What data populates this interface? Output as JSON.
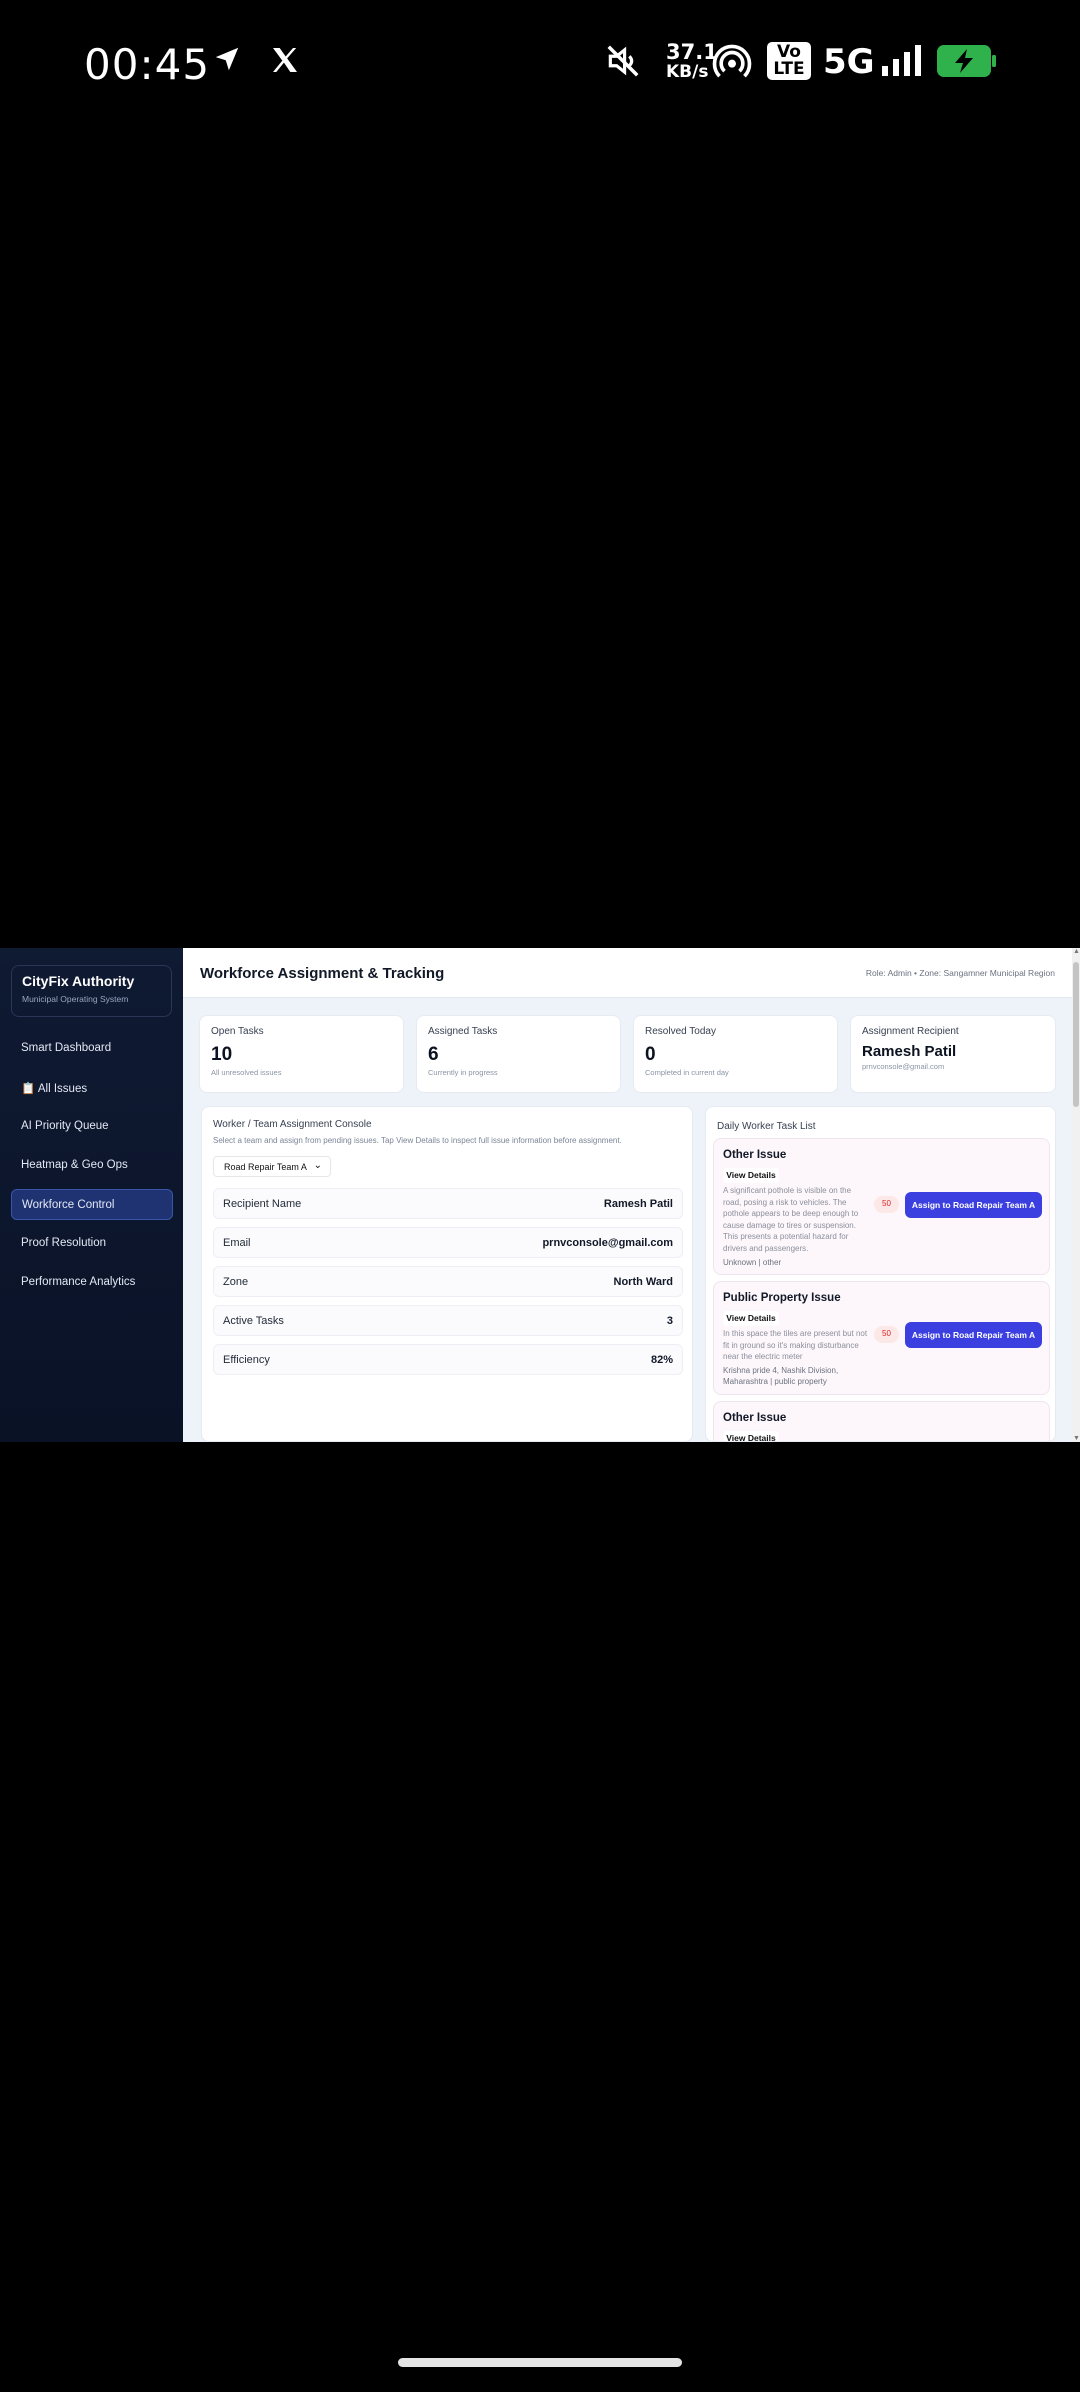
{
  "status_bar": {
    "time": "00:45",
    "net_speed_value": "37.1",
    "net_speed_unit": "KB/s",
    "volte_line1": "Vo",
    "volte_line2": "LTE",
    "network": "5G",
    "icons": [
      "location-arrow-icon",
      "x-logo-icon",
      "mute-icon",
      "hotspot-icon",
      "signal-icon",
      "battery-charging-icon"
    ]
  },
  "sidebar": {
    "brand_title": "CityFix Authority",
    "brand_subtitle": "Municipal Operating System",
    "items": [
      {
        "label": "Smart Dashboard"
      },
      {
        "label": "📋 All Issues"
      },
      {
        "label": "AI Priority Queue"
      },
      {
        "label": "Heatmap & Geo Ops"
      },
      {
        "label": "Workforce Control",
        "active": true
      },
      {
        "label": "Proof Resolution"
      },
      {
        "label": "Performance Analytics"
      }
    ]
  },
  "header": {
    "title": "Workforce Assignment & Tracking",
    "role_text": "Role: Admin • Zone: Sangamner Municipal Region"
  },
  "stats": [
    {
      "label": "Open Tasks",
      "value": "10",
      "sub": "All unresolved issues"
    },
    {
      "label": "Assigned Tasks",
      "value": "6",
      "sub": "Currently in progress"
    },
    {
      "label": "Resolved Today",
      "value": "0",
      "sub": "Completed in current day"
    },
    {
      "label": "Assignment Recipient",
      "value": "Ramesh Patil",
      "sub": "prnvconsole@gmail.com"
    }
  ],
  "console": {
    "title": "Worker / Team Assignment Console",
    "hint": "Select a team and assign from pending issues. Tap View Details to inspect full issue information before assignment.",
    "selected_team": "Road Repair Team A",
    "rows": [
      {
        "key": "Recipient Name",
        "value": "Ramesh Patil"
      },
      {
        "key": "Email",
        "value": "prnvconsole@gmail.com"
      },
      {
        "key": "Zone",
        "value": "North Ward"
      },
      {
        "key": "Active Tasks",
        "value": "3"
      },
      {
        "key": "Efficiency",
        "value": "82%"
      }
    ]
  },
  "task_list": {
    "title": "Daily Worker Task List",
    "view_label": "View Details",
    "items": [
      {
        "title": "Other Issue",
        "description": "A significant pothole is visible on the road, posing a risk to vehicles. The pothole appears to be deep enough to cause damage to tires or suspension. This presents a potential hazard for drivers and passengers.",
        "location": "Unknown | other",
        "score": "50",
        "assign_label": "Assign to Road Repair Team A"
      },
      {
        "title": "Public Property Issue",
        "description": "In this space the tiles are present but not fit in ground so it's making disturbance near the electric meter",
        "location": "Krishna pride 4, Nashik Division, Maharashtra | public property",
        "score": "50",
        "assign_label": "Assign to Road Repair Team A"
      },
      {
        "title": "Other Issue",
        "description": "",
        "location": "",
        "score": "",
        "assign_label": ""
      }
    ]
  }
}
